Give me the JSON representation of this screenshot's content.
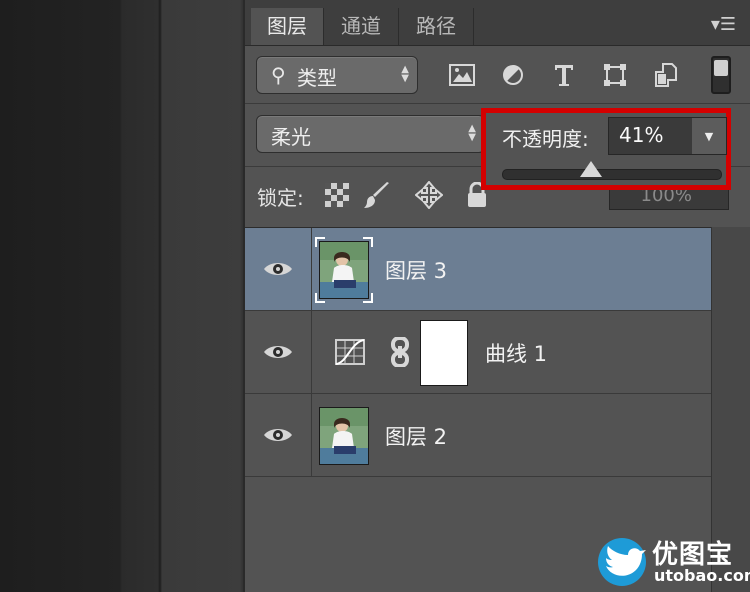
{
  "tabs": [
    {
      "label": "图层",
      "active": true
    },
    {
      "label": "通道",
      "active": false
    },
    {
      "label": "路径",
      "active": false
    }
  ],
  "filter": {
    "label": "类型",
    "icons": [
      "image-filter-icon",
      "adjustment-filter-icon",
      "type-filter-icon",
      "shape-filter-icon",
      "smart-object-filter-icon"
    ]
  },
  "blend": {
    "mode": "柔光"
  },
  "opacity": {
    "label": "不透明度:",
    "value": "41%",
    "percent": 41
  },
  "lock": {
    "label": "锁定:"
  },
  "fill": {
    "value": "100%"
  },
  "layers": [
    {
      "name": "图层 3",
      "selected": true,
      "type": "pixel"
    },
    {
      "name": "曲线 1",
      "selected": false,
      "type": "curves-adjustment"
    },
    {
      "name": "图层 2",
      "selected": false,
      "type": "pixel"
    }
  ],
  "watermark": {
    "title": "优图宝",
    "url": "utobao.com"
  },
  "colors": {
    "panel": "#535353",
    "selected_row": "#6c7e93",
    "highlight": "#d40000"
  }
}
